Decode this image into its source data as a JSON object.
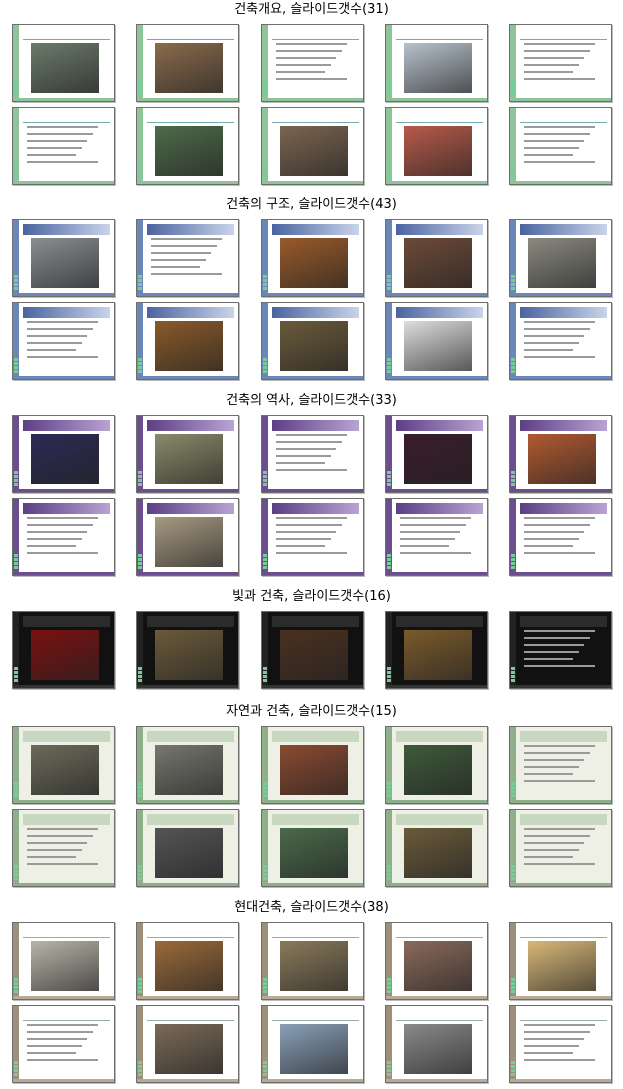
{
  "sections": [
    {
      "title": "건축개요, 슬라이드갯수(31)",
      "theme": "t-green",
      "thumbs": [
        {
          "icon": "title-slide",
          "photo": "#6b7a6a"
        },
        {
          "icon": "photo-slide",
          "photo": "#8a6b4b"
        },
        {
          "icon": "text-slide",
          "photo": ""
        },
        {
          "icon": "photo-slide",
          "photo": "#b7c2cc"
        },
        {
          "icon": "text-slide",
          "photo": ""
        },
        {
          "icon": "text-slide",
          "photo": ""
        },
        {
          "icon": "photo-slide",
          "photo": "#4e6b4a"
        },
        {
          "icon": "photo-slide",
          "photo": "#7b6550"
        },
        {
          "icon": "photo-slide",
          "photo": "#b85a4a"
        },
        {
          "icon": "text-slide",
          "photo": ""
        }
      ]
    },
    {
      "title": "건축의 구조, 슬라이드갯수(43)",
      "theme": "t-blue",
      "thumbs": [
        {
          "icon": "title-slide",
          "photo": "#8a8e92"
        },
        {
          "icon": "text-slide",
          "photo": ""
        },
        {
          "icon": "photo-slide",
          "photo": "#9a5a2a"
        },
        {
          "icon": "photo-slide",
          "photo": "#6d4a38"
        },
        {
          "icon": "photo-slide",
          "photo": "#8a8a80"
        },
        {
          "icon": "text-slide",
          "photo": ""
        },
        {
          "icon": "photo-slide",
          "photo": "#8a5a2a"
        },
        {
          "icon": "photo-slide",
          "photo": "#6a5a3a"
        },
        {
          "icon": "diagram-slide",
          "photo": "#dddddd"
        },
        {
          "icon": "text-slide",
          "photo": ""
        }
      ]
    },
    {
      "title": "건축의 역사, 슬라이드갯수(33)",
      "theme": "t-purple",
      "thumbs": [
        {
          "icon": "title-slide",
          "photo": "#2c2a55"
        },
        {
          "icon": "photo-slide",
          "photo": "#8a8a6a"
        },
        {
          "icon": "text-slide",
          "photo": ""
        },
        {
          "icon": "photo-slide",
          "photo": "#3a1c2c"
        },
        {
          "icon": "photo-slide",
          "photo": "#b25a30"
        },
        {
          "icon": "text-slide",
          "photo": ""
        },
        {
          "icon": "photo-slide",
          "photo": "#a89a82"
        },
        {
          "icon": "text-slide",
          "photo": ""
        },
        {
          "icon": "text-slide",
          "photo": ""
        },
        {
          "icon": "text-slide",
          "photo": ""
        }
      ]
    },
    {
      "title": "빛과 건축, 슬라이드갯수(16)",
      "theme": "t-dark",
      "thumbs": [
        {
          "icon": "title-slide",
          "photo": "#7a1010"
        },
        {
          "icon": "photo-slide",
          "photo": "#6b5a3a"
        },
        {
          "icon": "photo-slide",
          "photo": "#4a3020"
        },
        {
          "icon": "photo-slide",
          "photo": "#7a5a2a"
        },
        {
          "icon": "text-slide",
          "photo": ""
        }
      ]
    },
    {
      "title": "자연과 건축, 슬라이드갯수(15)",
      "theme": "t-sage",
      "thumbs": [
        {
          "icon": "title-slide",
          "photo": "#6b6b5a"
        },
        {
          "icon": "photo-slide",
          "photo": "#777770"
        },
        {
          "icon": "photo-slide",
          "photo": "#8a4a30"
        },
        {
          "icon": "photo-slide",
          "photo": "#3e5a3a"
        },
        {
          "icon": "text-slide",
          "photo": ""
        },
        {
          "icon": "text-slide",
          "photo": ""
        },
        {
          "icon": "photo-slide",
          "photo": "#555555"
        },
        {
          "icon": "photo-slide",
          "photo": "#4a6a4a"
        },
        {
          "icon": "photo-slide",
          "photo": "#6a5a3a"
        },
        {
          "icon": "text-slide",
          "photo": ""
        }
      ]
    },
    {
      "title": "현대건축, 슬라이드갯수(38)",
      "theme": "t-brown",
      "thumbs": [
        {
          "icon": "title-slide",
          "photo": "#b8b4a8"
        },
        {
          "icon": "photo-slide",
          "photo": "#9a6a3a"
        },
        {
          "icon": "photo-slide",
          "photo": "#8a7a5a"
        },
        {
          "icon": "photo-slide",
          "photo": "#8a6a5a"
        },
        {
          "icon": "photo-slide",
          "photo": "#d8b878"
        },
        {
          "icon": "text-slide",
          "photo": ""
        },
        {
          "icon": "photo-slide",
          "photo": "#7a6a58"
        },
        {
          "icon": "photo-slide",
          "photo": "#8aa0b8"
        },
        {
          "icon": "photo-slide",
          "photo": "#8a8a8a"
        },
        {
          "icon": "text-slide",
          "photo": ""
        }
      ]
    }
  ]
}
